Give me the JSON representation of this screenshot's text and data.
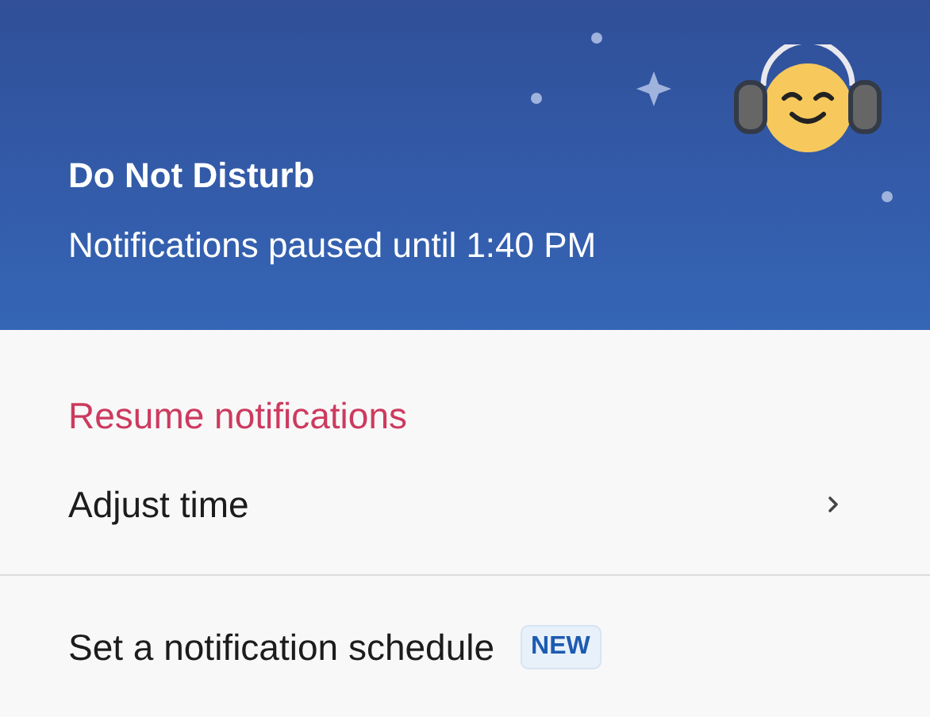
{
  "header": {
    "title": "Do Not Disturb",
    "subtitle": "Notifications paused until 1:40 PM"
  },
  "menu_groups": [
    {
      "items": [
        {
          "kind": "danger",
          "label": "Resume notifications"
        },
        {
          "kind": "submenu",
          "label": "Adjust time"
        }
      ]
    },
    {
      "items": [
        {
          "kind": "plain",
          "label": "Set a notification schedule",
          "badge": "NEW"
        }
      ]
    }
  ]
}
